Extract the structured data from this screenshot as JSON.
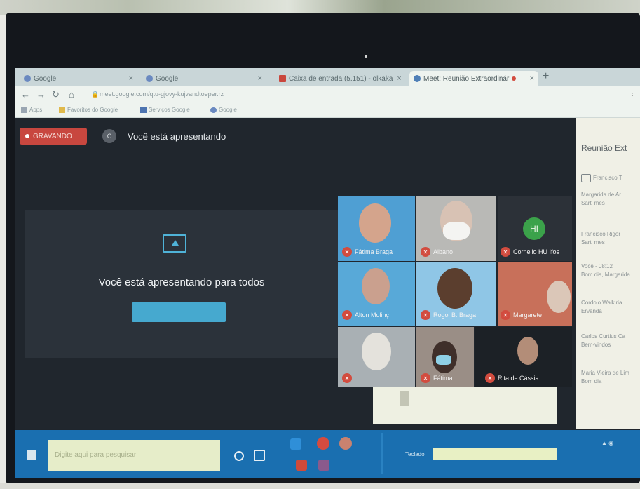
{
  "browser": {
    "tabs": [
      {
        "label": "Google",
        "active": false
      },
      {
        "label": "Google",
        "active": false
      },
      {
        "label": "Caixa de entrada (5.151) - olkaka",
        "active": false
      },
      {
        "label": "Meet: Reunião Extraordinár",
        "active": true
      }
    ],
    "new_tab": "+",
    "url": "meet.google.com/qtu-gjovy-kujvandtoeper.rz",
    "bookmarks": [
      "Apps",
      "Favoritos do Google",
      "Serviços Google",
      "Google"
    ]
  },
  "meet": {
    "recording_label": "GRAVANDO",
    "presenting_banner": "Você está apresentando",
    "presenter_avatar": "C",
    "present_message": "Você está apresentando para todos",
    "participants": [
      {
        "name": "Fátima Braga"
      },
      {
        "name": "Albano"
      },
      {
        "name": "Cornelio HU Ifos",
        "initials": "HI"
      },
      {
        "name": "Alton Molinç"
      },
      {
        "name": "Rogol B. Braga"
      },
      {
        "name": "Margarete"
      },
      {
        "name": ""
      },
      {
        "name": "Fátima"
      },
      {
        "name": "Rita de Cássia"
      }
    ]
  },
  "sidebar": {
    "title": "Reunião Ext",
    "entries": [
      "Francisco T",
      "Margarida de Ar",
      "Sarti mes",
      "Francisco Rigor",
      "Sarti mes",
      "Você - 08:12",
      "Bom dia, Margarida",
      "Cordolo Walkiria",
      "Ervanda",
      "Carlos Curtius Ca",
      "Bem-vindos",
      "Maria Vieira de Lim",
      "Bom dia"
    ]
  },
  "taskbar": {
    "search_placeholder": "Digite aqui para pesquisar",
    "field_label": "Teclado"
  }
}
